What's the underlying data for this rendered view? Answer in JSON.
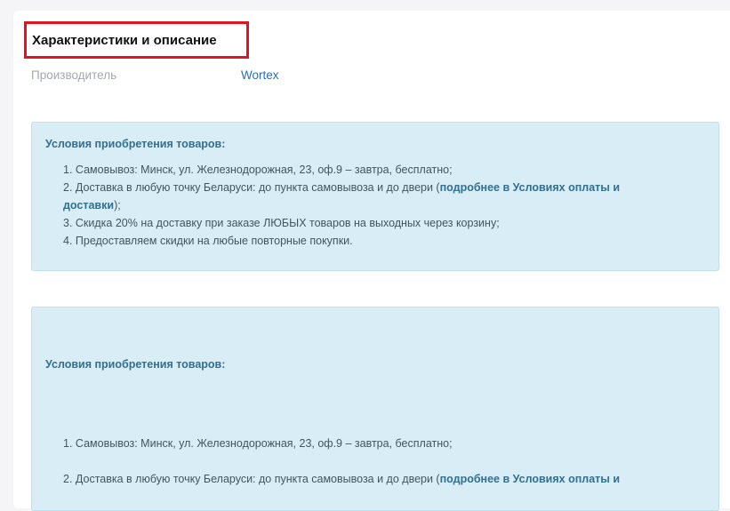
{
  "section": {
    "title": "Характеристики и описание"
  },
  "specs": [
    {
      "label": "Производитель",
      "value": "Wortex"
    }
  ],
  "conditions_box": {
    "heading": "Условия приобретения товаров:",
    "item1": "1. Самовывоз: Минск, ул. Железнодорожная, 23, оф.9 – завтра, бесплатно;",
    "item2_prefix": "2. Доставка в любую точку Беларуси: до пункта самовывоза и до двери (",
    "item2_link": "подробнее в Условиях оплаты и доставки",
    "item2_suffix": ");",
    "item3": "3. Скидка 20% на доставку при заказе ЛЮБЫХ товаров на выходных через корзину;",
    "item4": "4. Предоставляем скидки на любые повторные покупки."
  },
  "conditions_box_2": {
    "heading": "Условия приобретения товаров:",
    "item1": "1. Самовывоз: Минск, ул. Железнодорожная, 23, оф.9 – завтра, бесплатно;",
    "item2_prefix": "2. Доставка в любую точку Беларуси: до пункта самовывоза и до двери (",
    "item2_link": "подробнее в Условиях оплаты и"
  }
}
